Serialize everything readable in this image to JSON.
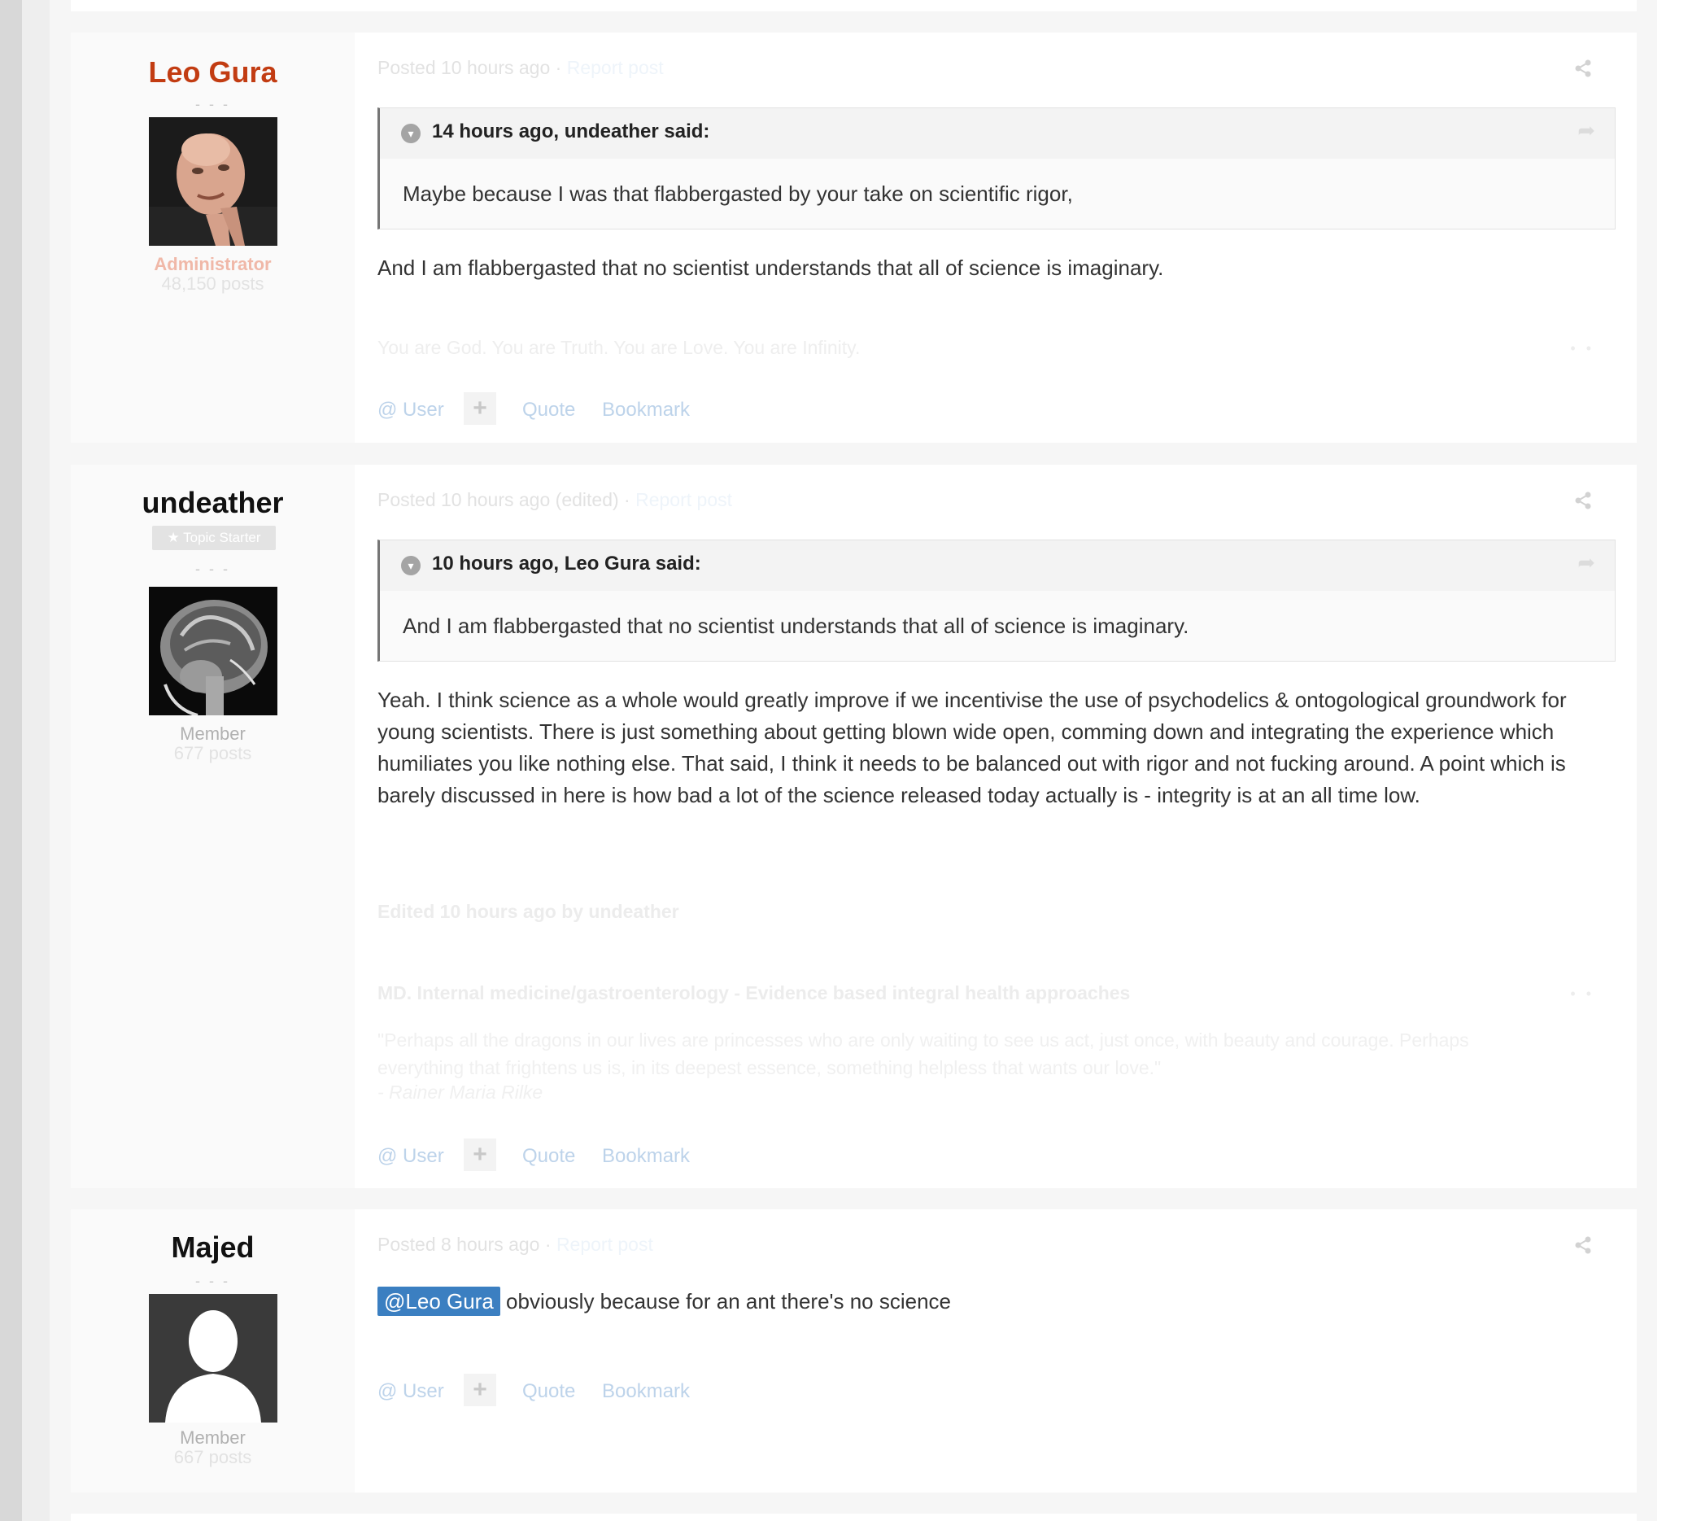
{
  "posts": [
    {
      "author": "Leo Gura",
      "name_color": "#c23c12",
      "dashes": "- - -",
      "role": "Administrator",
      "post_count": "48,150 posts",
      "meta_posted": "Posted 10 hours ago",
      "meta_separator": "·",
      "meta_report": "Report post",
      "quote": {
        "title": "14 hours ago, undeather said:",
        "text": "Maybe because I was that flabbergasted by your take on scientific rigor,"
      },
      "body": "And I am flabbergasted that no scientist understands that all of science is imaginary.",
      "signature": "You are God. You are Truth. You are Love. You are Infinity.",
      "signature_dots": "• •",
      "controls": {
        "user": "@ User",
        "plus": "+",
        "quote": "Quote",
        "bookmark": "Bookmark"
      }
    },
    {
      "author": "undeather",
      "name_color": "#111111",
      "badge": "★ Topic Starter",
      "dashes": "- - -",
      "role": "Member",
      "post_count": "677 posts",
      "meta_posted": "Posted 10 hours ago (edited)",
      "meta_separator": "·",
      "meta_report": "Report post",
      "quote": {
        "title": "10 hours ago, Leo Gura said:",
        "text": "And I am flabbergasted that no scientist understands that all of science is imaginary."
      },
      "body": "Yeah. I think science as a whole would greatly improve if we incentivise the use of psychodelics & ontogological groundwork for young scientists. There is just something about getting blown wide open, comming down and integrating the experience which humiliates you like nothing else. That said, I think it needs to be balanced out with rigor and not fucking around. A point which is barely discussed in here is how bad a lot of the science released today actually is - integrity is at an all time low.",
      "edited_note": "Edited 10 hours ago by undeather",
      "signature_title": "MD. Internal medicine/gastroenterology - Evidence based integral health approaches",
      "signature_dots": "• •",
      "signature_quote": "\"Perhaps all the dragons in our lives are princesses who are only waiting to see us act, just once, with beauty and courage. Perhaps everything that frightens us is, in its deepest essence, something helpless that wants our love.\"",
      "signature_author": "- Rainer Maria Rilke",
      "controls": {
        "user": "@ User",
        "plus": "+",
        "quote": "Quote",
        "bookmark": "Bookmark"
      }
    },
    {
      "author": "Majed",
      "name_color": "#111111",
      "dashes": "- - -",
      "role": "Member",
      "post_count": "667 posts",
      "meta_posted": "Posted 8 hours ago",
      "meta_separator": "·",
      "meta_report": "Report post",
      "mention": "@Leo Gura",
      "body": "obviously because for an ant there's no science",
      "controls": {
        "user": "@ User",
        "plus": "+",
        "quote": "Quote",
        "bookmark": "Bookmark"
      }
    }
  ],
  "icons": {
    "share": "share-icon",
    "quote_toggle": "chevron-down-circle-icon",
    "quote_share": "reply-arrow-icon"
  },
  "colors": {
    "admin_name": "#c23c12",
    "mention_bg": "#3b7fc1",
    "link": "#bdd3ea"
  }
}
